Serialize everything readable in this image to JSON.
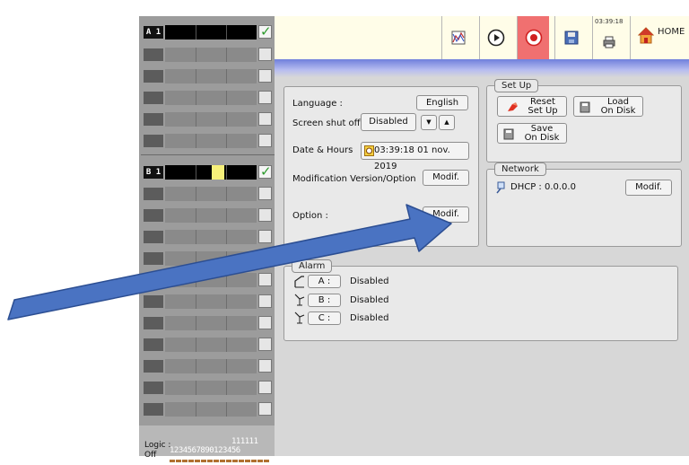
{
  "toolbar": {
    "time": "03:39:18",
    "home_label": "HOME",
    "buttons": [
      "chart-icon",
      "play-icon",
      "record-icon",
      "disk-icon",
      "printer-icon",
      "home-icon"
    ]
  },
  "channels": {
    "a_label": "A 1",
    "b_label": "B 1"
  },
  "logic": {
    "label": "Logic :",
    "state": "Off",
    "numbers_top": "111111",
    "numbers": "1234567890123456"
  },
  "general": {
    "language_label": "Language :",
    "language_value": "English",
    "screen_shutoff_label": "Screen shut off :",
    "screen_shutoff_value": "Disabled",
    "date_label": "Date & Hours",
    "date_value": "03:39:18 01 nov. 2019",
    "modif_version_label": "Modification Version/Option",
    "modif_button": "Modif.",
    "option_label": "Option :",
    "option_button": "Modif."
  },
  "setup": {
    "title": "Set Up",
    "reset_line1": "Reset",
    "reset_line2": "Set Up",
    "load_line1": "Load",
    "load_line2": "On Disk",
    "save_line1": "Save",
    "save_line2": "On Disk"
  },
  "network": {
    "title": "Network",
    "dhcp_text": "DHCP : 0.0.0.0",
    "modif_button": "Modif."
  },
  "alarm": {
    "title": "Alarm",
    "rows": [
      {
        "label": "A :",
        "status": "Disabled"
      },
      {
        "label": "B :",
        "status": "Disabled"
      },
      {
        "label": "C :",
        "status": "Disabled"
      }
    ]
  },
  "colors": {
    "arrow": "#4a73c2",
    "record": "#f07070",
    "header_gradient": "#6f7fdc"
  }
}
